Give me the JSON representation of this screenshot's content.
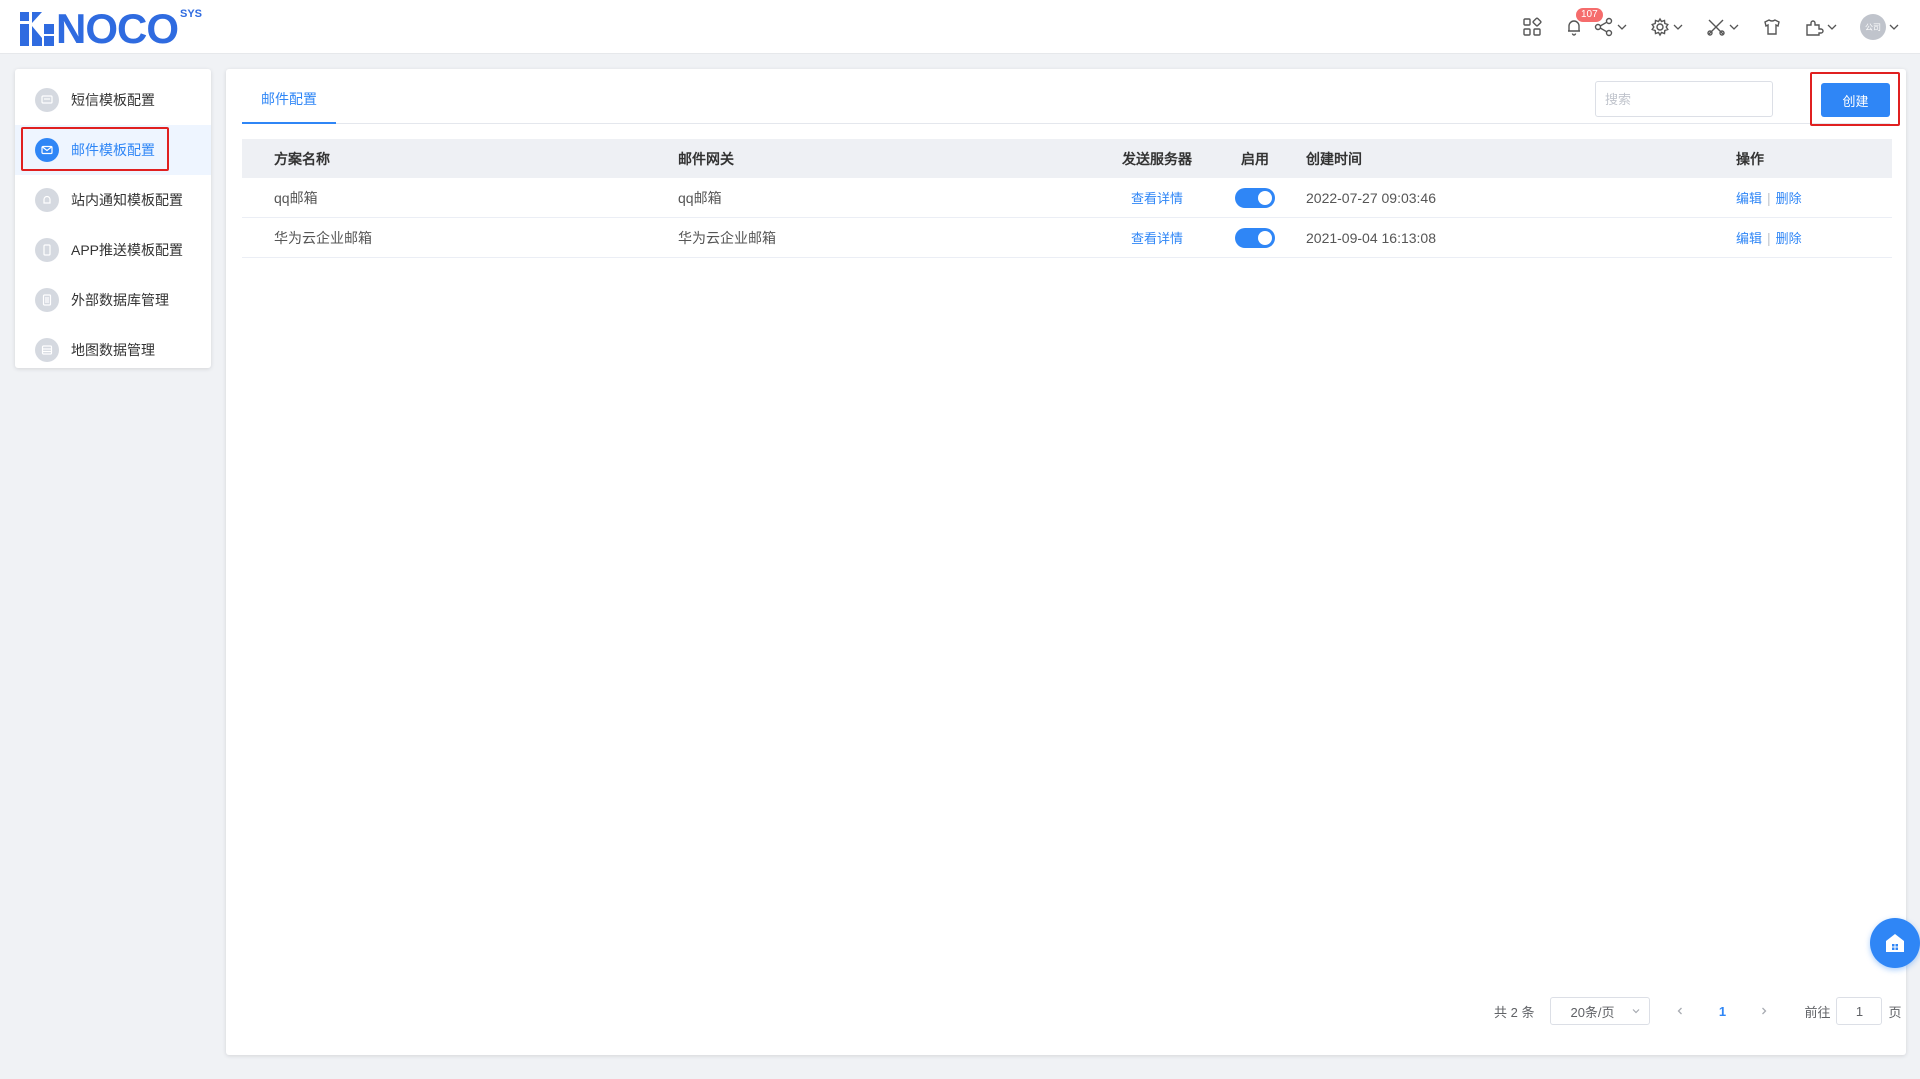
{
  "brand": {
    "name": "NOCO",
    "suffix": "SYS",
    "color": "#2f6be0"
  },
  "header": {
    "notification_count": "107",
    "avatar_text": "公司",
    "icons": [
      "apps-grid-icon",
      "bell-icon",
      "share-icon",
      "gear-icon",
      "tools-icon",
      "shirt-icon",
      "puzzle-icon"
    ]
  },
  "sidebar": {
    "items": [
      {
        "label": "短信模板配置",
        "icon": "message-icon",
        "active": false
      },
      {
        "label": "邮件模板配置",
        "icon": "mail-icon",
        "active": true
      },
      {
        "label": "站内通知模板配置",
        "icon": "notice-icon",
        "active": false
      },
      {
        "label": "APP推送模板配置",
        "icon": "phone-icon",
        "active": false
      },
      {
        "label": "外部数据库管理",
        "icon": "document-icon",
        "active": false
      },
      {
        "label": "地图数据管理",
        "icon": "list-icon",
        "active": false
      }
    ]
  },
  "main": {
    "tab_label": "邮件配置",
    "search_placeholder": "搜索",
    "create_label": "创建",
    "columns": [
      "方案名称",
      "邮件网关",
      "发送服务器",
      "启用",
      "创建时间",
      "操作"
    ],
    "rows": [
      {
        "name": "qq邮箱",
        "gateway": "qq邮箱",
        "server_link": "查看详情",
        "enabled": true,
        "created": "2022-07-27 09:03:46",
        "edit": "编辑",
        "delete": "删除"
      },
      {
        "name": "华为云企业邮箱",
        "gateway": "华为云企业邮箱",
        "server_link": "查看详情",
        "enabled": true,
        "created": "2021-09-04 16:13:08",
        "edit": "编辑",
        "delete": "删除"
      }
    ],
    "pagination": {
      "total_text": "共 2 条",
      "page_size": "20条/页",
      "current_page": "1",
      "goto_label": "前往",
      "goto_value": "1",
      "page_suffix": "页"
    }
  },
  "colors": {
    "accent": "#2f86f6",
    "badge": "#f56c6c",
    "highlight_box": "#e02020"
  }
}
